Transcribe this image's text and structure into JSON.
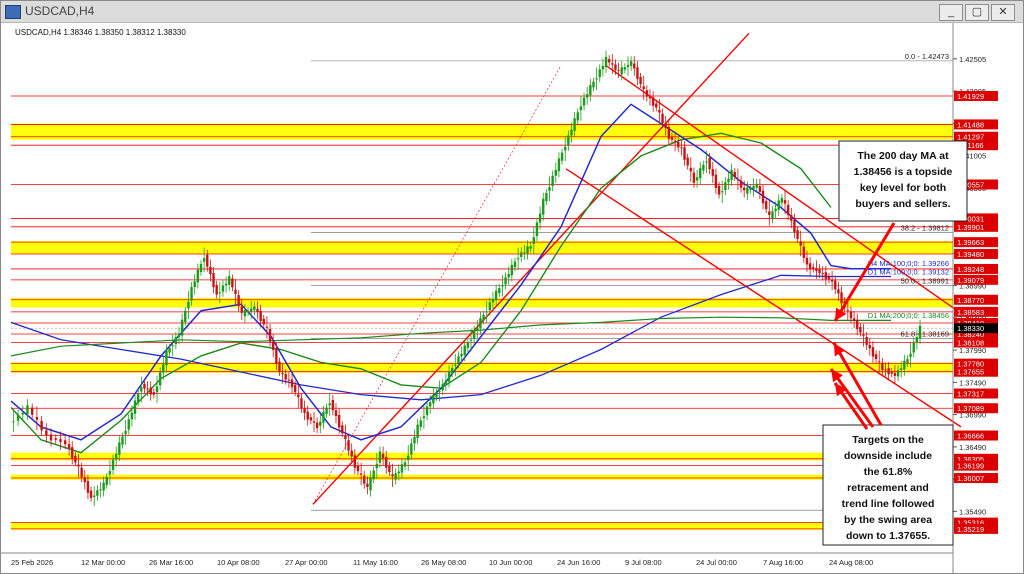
{
  "window": {
    "title": "USDCAD,H4",
    "controls": [
      "_",
      "▢",
      "✕"
    ]
  },
  "chart_data": {
    "type": "line",
    "symbol_info": "USDCAD,H4  1.38346 1.38350 1.38312 1.38330",
    "ylim": [
      1.35,
      1.4275
    ],
    "price_levels": [
      "1.42505",
      "1.42005",
      "1.41505",
      "1.41005",
      "1.40505",
      "1.40005",
      "1.39490",
      "1.38990",
      "1.38490",
      "1.37990",
      "1.37490",
      "1.36990",
      "1.36490",
      "1.35990",
      "1.35490"
    ],
    "price_values": [
      1.42505,
      1.42005,
      1.41505,
      1.41005,
      1.40505,
      1.40005,
      1.3949,
      1.3899,
      1.3849,
      1.3799,
      1.3749,
      1.3699,
      1.3649,
      1.3599,
      1.3549
    ],
    "red_levels": [
      "1.41929",
      "1.41488",
      "1.41297",
      "1.41166",
      "1.40557",
      "1.40031",
      "1.39901",
      "1.39663",
      "1.39480",
      "1.39248",
      "1.39079",
      "1.38770",
      "1.38583",
      "1.38410",
      "1.38240",
      "1.38108",
      "1.37780",
      "1.37655",
      "1.37317",
      "1.37089",
      "1.36666",
      "1.36305",
      "1.36199",
      "1.36007",
      "1.35316",
      "1.35219"
    ],
    "red_values": [
      1.41929,
      1.41488,
      1.41297,
      1.41166,
      1.40557,
      1.40031,
      1.39901,
      1.39663,
      1.3948,
      1.39248,
      1.39079,
      1.3877,
      1.38583,
      1.3841,
      1.3824,
      1.38108,
      1.3778,
      1.37655,
      1.37317,
      1.37089,
      1.36666,
      1.36305,
      1.36199,
      1.36007,
      1.35316,
      1.35219
    ],
    "current_price": "1.38330",
    "current_value": 1.3833,
    "zones": [
      [
        1.4125,
        1.415
      ],
      [
        1.3948,
        1.3968
      ],
      [
        1.3865,
        1.388
      ],
      [
        1.3764,
        1.378
      ],
      [
        1.3628,
        1.364
      ],
      [
        1.3598,
        1.3606
      ],
      [
        1.352,
        1.3532
      ]
    ],
    "x_labels": [
      "25 Feb 2026",
      "12 Mar 00:00",
      "26 Mar 16:00",
      "10 Apr 08:00",
      "27 Apr 00:00",
      "11 May 16:00",
      "26 May 08:00",
      "10 Jun 00:00",
      "24 Jun 16:00",
      "9 Jul 08:00",
      "24 Jul 00:00",
      "7 Aug 16:00",
      "24 Aug 08:00"
    ],
    "price_path": [
      [
        0,
        1.3685
      ],
      [
        3,
        1.371
      ],
      [
        6,
        1.3665
      ],
      [
        9,
        1.3655
      ],
      [
        11,
        1.3615
      ],
      [
        13,
        1.357
      ],
      [
        15,
        1.359
      ],
      [
        17,
        1.364
      ],
      [
        19,
        1.369
      ],
      [
        21,
        1.3745
      ],
      [
        23,
        1.373
      ],
      [
        25,
        1.3795
      ],
      [
        27,
        1.3825
      ],
      [
        29,
        1.3895
      ],
      [
        31,
        1.3945
      ],
      [
        33,
        1.3885
      ],
      [
        35,
        1.391
      ],
      [
        37,
        1.3855
      ],
      [
        39,
        1.3865
      ],
      [
        41,
        1.383
      ],
      [
        43,
        1.3765
      ],
      [
        45,
        1.3745
      ],
      [
        47,
        1.37
      ],
      [
        49,
        1.368
      ],
      [
        51,
        1.372
      ],
      [
        53,
        1.367
      ],
      [
        55,
        1.362
      ],
      [
        57,
        1.3585
      ],
      [
        59,
        1.364
      ],
      [
        61,
        1.36
      ],
      [
        63,
        1.3625
      ],
      [
        65,
        1.368
      ],
      [
        67,
        1.372
      ],
      [
        69,
        1.3745
      ],
      [
        71,
        1.378
      ],
      [
        73,
        1.381
      ],
      [
        75,
        1.3845
      ],
      [
        77,
        1.388
      ],
      [
        79,
        1.391
      ],
      [
        81,
        1.3945
      ],
      [
        83,
        1.396
      ],
      [
        85,
        1.403
      ],
      [
        87,
        1.408
      ],
      [
        89,
        1.413
      ],
      [
        91,
        1.418
      ],
      [
        93,
        1.4215
      ],
      [
        95,
        1.425
      ],
      [
        97,
        1.423
      ],
      [
        99,
        1.4245
      ],
      [
        101,
        1.42
      ],
      [
        103,
        1.4175
      ],
      [
        105,
        1.413
      ],
      [
        107,
        1.411
      ],
      [
        109,
        1.406
      ],
      [
        111,
        1.4095
      ],
      [
        113,
        1.404
      ],
      [
        115,
        1.4075
      ],
      [
        117,
        1.4045
      ],
      [
        119,
        1.4055
      ],
      [
        121,
        1.4005
      ],
      [
        123,
        1.4035
      ],
      [
        125,
        1.3985
      ],
      [
        127,
        1.393
      ],
      [
        129,
        1.392
      ],
      [
        131,
        1.3905
      ],
      [
        133,
        1.3865
      ],
      [
        135,
        1.3835
      ],
      [
        137,
        1.38
      ],
      [
        139,
        1.377
      ],
      [
        141,
        1.376
      ],
      [
        143,
        1.3785
      ],
      [
        145,
        1.3833
      ]
    ],
    "path_max_x": 150,
    "fib_labels": [
      {
        "text": "0.0 - 1.42473",
        "value": 1.42473
      },
      {
        "text": "38.2 - 1.39812",
        "value": 1.39812
      },
      {
        "text": "50.0 - 1.38991",
        "value": 1.38991
      },
      {
        "text": "61.8 - 1.38169",
        "value": 1.38169
      },
      {
        "text": "1.35508",
        "value": 1.35508
      }
    ],
    "ma_labels": [
      {
        "text": "H4 MA:100;0;0: 1.39266",
        "value": 1.39266,
        "color": "#1f2bd0"
      },
      {
        "text": "D1 MA:100;0;0: 1.39132",
        "value": 1.39132,
        "color": "#1f2bd0"
      },
      {
        "text": "D1 MA:200;0;0: 1.38456",
        "value": 1.38456,
        "color": "#1a8a1a"
      },
      {
        "text": "25",
        "value": 1.4015,
        "color": "#1a8a1a"
      }
    ],
    "annotations": [
      {
        "lines": [
          "The 200 day MA at",
          "1.38456 is a topside",
          "key level for both",
          "buyers and sellers."
        ]
      },
      {
        "lines": [
          "Targets on the",
          "downside include",
          "the 61.8%",
          "retracement and",
          "trend line followed",
          "by the swing area",
          "down to 1.37655."
        ]
      }
    ],
    "colors": {
      "zone": "#ffff00",
      "red_line": "#ff0000",
      "blue_ma": "#1f2bd0",
      "green_ma": "#1a8a1a",
      "price_up": "#1a9c1a",
      "price_dn": "#cc1111"
    }
  }
}
